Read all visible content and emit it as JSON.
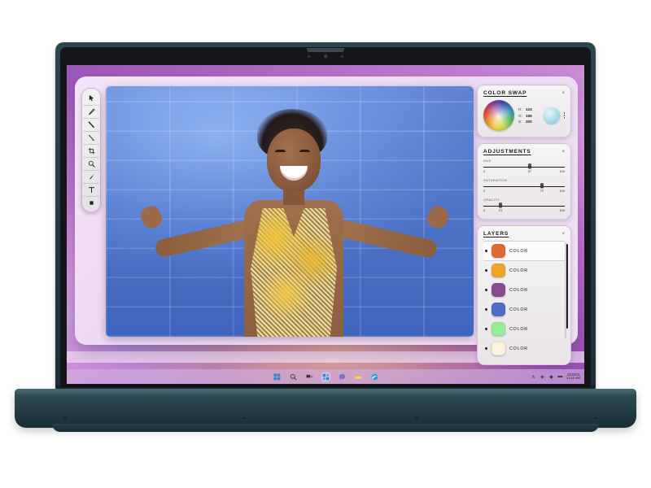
{
  "device": {
    "name": "laptop",
    "body_color": "#2b454f"
  },
  "desktop": {
    "wallpaper_name": "purple-gradient-wallpaper"
  },
  "app": {
    "title": "photo-editor",
    "toolbar": {
      "name": "tool-palette",
      "tools": [
        {
          "name": "cursor-arrow-tool",
          "glyph": "↖"
        },
        {
          "name": "pen-tool",
          "glyph": "✐"
        },
        {
          "name": "line-tool",
          "glyph": "╲"
        },
        {
          "name": "slash-tool",
          "glyph": "╲"
        },
        {
          "name": "crop-tool",
          "glyph": "⌗"
        },
        {
          "name": "zoom-tool",
          "glyph": "⚲"
        },
        {
          "name": "brush-tool",
          "glyph": "◢"
        },
        {
          "name": "text-tool",
          "glyph": "T"
        },
        {
          "name": "shape-tool",
          "glyph": "■"
        }
      ]
    },
    "canvas": {
      "name": "photo-canvas",
      "alt": "woman-smiling-against-blue-brick-wall"
    },
    "panels": {
      "color_swap": {
        "title": "COLOR SWAP",
        "close": "×",
        "wheel_name": "color-wheel",
        "channels": [
          {
            "key": "R:",
            "value": "124"
          },
          {
            "key": "G:",
            "value": "199"
          },
          {
            "key": "B:",
            "value": "200"
          }
        ],
        "preview_color": "#a8dde8"
      },
      "adjustments": {
        "title": "ADJUSTMENTS",
        "close": "×",
        "sliders": [
          {
            "label": "HUE",
            "value": 57,
            "min": "0",
            "max": "100",
            "value_text": "57"
          },
          {
            "label": "SATURATION",
            "value": 72,
            "min": "0",
            "max": "100",
            "value_text": "72"
          },
          {
            "label": "OPACITY",
            "value": 21,
            "min": "0",
            "max": "100",
            "value_text": "21"
          }
        ]
      },
      "layers": {
        "title": "LAYERS",
        "close": "×",
        "items": [
          {
            "label": "COLOR",
            "color": "#e06a33",
            "selected": true
          },
          {
            "label": "COLOR",
            "color": "#eda32c",
            "selected": false
          },
          {
            "label": "COLOR",
            "color": "#8a4a92",
            "selected": false
          },
          {
            "label": "COLOR",
            "color": "#4f6cc8",
            "selected": false
          },
          {
            "label": "COLOR",
            "color": "#96ef96",
            "selected": false
          },
          {
            "label": "COLOR",
            "color": "#fbf3dc",
            "selected": false
          }
        ]
      }
    }
  },
  "taskbar": {
    "icons": [
      {
        "name": "start-button",
        "glyph": "⊞"
      },
      {
        "name": "search-icon",
        "glyph": "⚲"
      },
      {
        "name": "task-view-icon",
        "glyph": "▭"
      },
      {
        "name": "widgets-icon",
        "glyph": "▣"
      },
      {
        "name": "chat-icon",
        "glyph": "○"
      },
      {
        "name": "file-explorer-icon",
        "glyph": "▰"
      },
      {
        "name": "edge-browser-icon",
        "glyph": "◔"
      }
    ],
    "tray": {
      "chevron": "∧",
      "network_icon": "◈",
      "volume_icon": "◆",
      "battery_icon": "▬",
      "time": "11:11 AM",
      "date": "10/20/21"
    }
  }
}
